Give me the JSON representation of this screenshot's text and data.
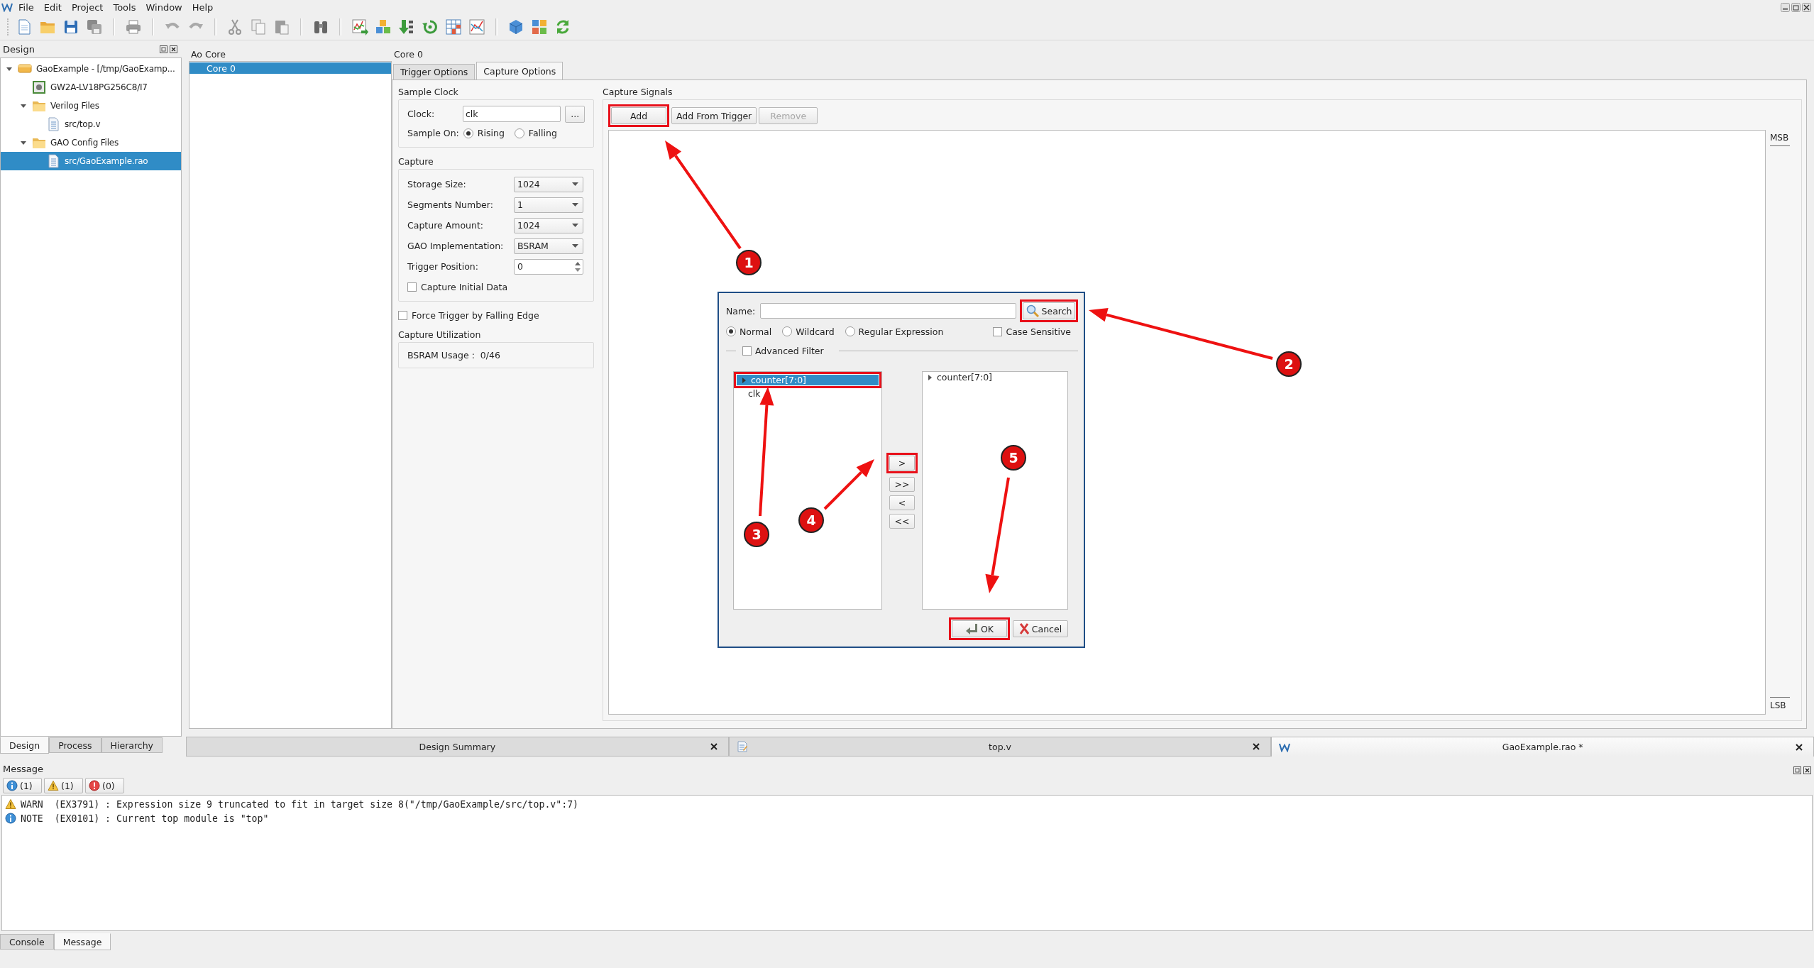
{
  "menu": [
    {
      "label": "File"
    },
    {
      "label": "Edit"
    },
    {
      "label": "Project"
    },
    {
      "label": "Tools"
    },
    {
      "label": "Window"
    },
    {
      "label": "Help"
    }
  ],
  "design_panel": {
    "title": "Design",
    "tree": [
      {
        "label": "GaoExample - [/tmp/GaoExamp...",
        "kind": "project",
        "expanded": true,
        "selected": false,
        "children": [
          {
            "label": "GW2A-LV18PG256C8/I7",
            "kind": "device",
            "selected": false
          },
          {
            "label": "Verilog Files",
            "kind": "folder",
            "expanded": true,
            "selected": false,
            "children": [
              {
                "label": "src/top.v",
                "kind": "file",
                "selected": false
              }
            ]
          },
          {
            "label": "GAO Config Files",
            "kind": "folder",
            "expanded": true,
            "selected": false,
            "children": [
              {
                "label": "src/GaoExample.rao",
                "kind": "file",
                "selected": true
              }
            ]
          }
        ]
      }
    ],
    "tabs": [
      {
        "label": "Design",
        "selected": true
      },
      {
        "label": "Process",
        "selected": false
      },
      {
        "label": "Hierarchy",
        "selected": false
      }
    ]
  },
  "ao_core": {
    "title": "Ao Core",
    "items": [
      {
        "label": "Core 0",
        "selected": true
      }
    ]
  },
  "core": {
    "title": "Core 0",
    "tabs": [
      {
        "label": "Trigger Options",
        "selected": false
      },
      {
        "label": "Capture Options",
        "selected": true
      }
    ],
    "sample_clock": {
      "title": "Sample Clock",
      "clock_label": "Clock:",
      "clock_value": "clk",
      "browse_button": "...",
      "sample_on_label": "Sample On:",
      "options": [
        {
          "label": "Rising",
          "selected": true
        },
        {
          "label": "Falling",
          "selected": false
        }
      ]
    },
    "capture": {
      "title": "Capture",
      "fields": [
        {
          "label": "Storage Size:",
          "value": "1024",
          "kind": "dropdown"
        },
        {
          "label": "Segments Number:",
          "value": "1",
          "kind": "dropdown"
        },
        {
          "label": "Capture Amount:",
          "value": "1024",
          "kind": "dropdown"
        },
        {
          "label": "GAO Implementation:",
          "value": "BSRAM",
          "kind": "dropdown"
        },
        {
          "label": "Trigger Position:",
          "value": "0",
          "kind": "spinbox"
        }
      ],
      "initial_data": {
        "label": "Capture Initial Data",
        "checked": false
      }
    },
    "force_trigger": {
      "label": "Force Trigger by Falling Edge",
      "checked": false
    },
    "utilization": {
      "title": "Capture Utilization",
      "text": "BSRAM Usage :  0/46"
    },
    "capture_signals": {
      "title": "Capture Signals",
      "buttons": [
        {
          "label": "Add",
          "disabled": false,
          "highlighted": true
        },
        {
          "label": "Add From Trigger",
          "disabled": false,
          "highlighted": false
        },
        {
          "label": "Remove",
          "disabled": true,
          "highlighted": false
        }
      ],
      "msb": "MSB",
      "lsb": "LSB"
    }
  },
  "editor_tabs": [
    {
      "label": "Design Summary",
      "kind": "summary",
      "selected": false
    },
    {
      "label": "top.v",
      "kind": "file",
      "selected": false
    },
    {
      "label": "GaoExample.rao *",
      "kind": "gao",
      "selected": true
    }
  ],
  "messages": {
    "title": "Message",
    "filters": [
      {
        "kind": "info",
        "label": "(1)"
      },
      {
        "kind": "warning",
        "label": "(1)"
      },
      {
        "kind": "error",
        "label": "(0)"
      }
    ],
    "rows": [
      {
        "kind": "warning",
        "text": "WARN  (EX3791) : Expression size 9 truncated to fit in target size 8(\"/tmp/GaoExample/src/top.v\":7)"
      },
      {
        "kind": "info",
        "text": "NOTE  (EX0101) : Current top module is \"top\""
      }
    ]
  },
  "bottom_tabs": [
    {
      "label": "Console",
      "selected": false
    },
    {
      "label": "Message",
      "selected": true
    }
  ],
  "dialog": {
    "name_label": "Name:",
    "search_button": {
      "label": "Search",
      "highlighted": true
    },
    "match_modes": [
      {
        "label": "Normal",
        "selected": true
      },
      {
        "label": "Wildcard",
        "selected": false
      },
      {
        "label": "Regular Expression",
        "selected": false
      }
    ],
    "case_sensitive": {
      "label": "Case Sensitive",
      "checked": false
    },
    "advanced_filter": {
      "label": "Advanced Filter",
      "checked": false
    },
    "available": [
      {
        "label": "counter[7:0]",
        "expandable": true,
        "selected": true,
        "highlighted": true
      },
      {
        "label": "clk",
        "expandable": false,
        "selected": false,
        "highlighted": false
      }
    ],
    "move_buttons": [
      {
        "label": ">",
        "highlighted": true
      },
      {
        "label": ">>",
        "highlighted": false
      },
      {
        "label": "<",
        "highlighted": false
      },
      {
        "label": "<<",
        "highlighted": false
      }
    ],
    "chosen": [
      {
        "label": "counter[7:0]",
        "expandable": true,
        "selected": false,
        "highlighted": false
      }
    ],
    "ok_button": {
      "label": "OK",
      "highlighted": true
    },
    "cancel_button": {
      "label": "Cancel",
      "highlighted": false
    }
  },
  "annotations": [
    {
      "number": "1"
    },
    {
      "number": "2"
    },
    {
      "number": "3"
    },
    {
      "number": "4"
    },
    {
      "number": "5"
    }
  ]
}
